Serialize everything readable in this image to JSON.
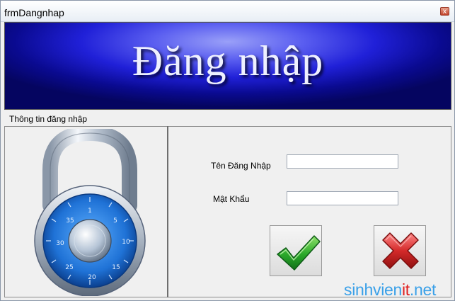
{
  "window": {
    "title": "frmDangnhap",
    "close_glyph": "x"
  },
  "banner": {
    "text": "Đăng nhập"
  },
  "group": {
    "label": "Thông tin đăng nhập"
  },
  "form": {
    "username_label": "Tên Đăng Nhập",
    "username_value": "",
    "password_label": "Mật Khẩu",
    "password_value": ""
  },
  "icons": {
    "lock": "padlock-icon",
    "ok": "check-icon",
    "cancel": "cross-icon"
  },
  "watermark": {
    "part1": "sinhvien",
    "part2": "it",
    "part3": ".net"
  },
  "colors": {
    "banner_blue": "#1414c8",
    "check_green": "#2aa82a",
    "cross_red": "#d42a2a",
    "watermark_blue": "#3aa0e8",
    "watermark_red": "#e02020"
  }
}
